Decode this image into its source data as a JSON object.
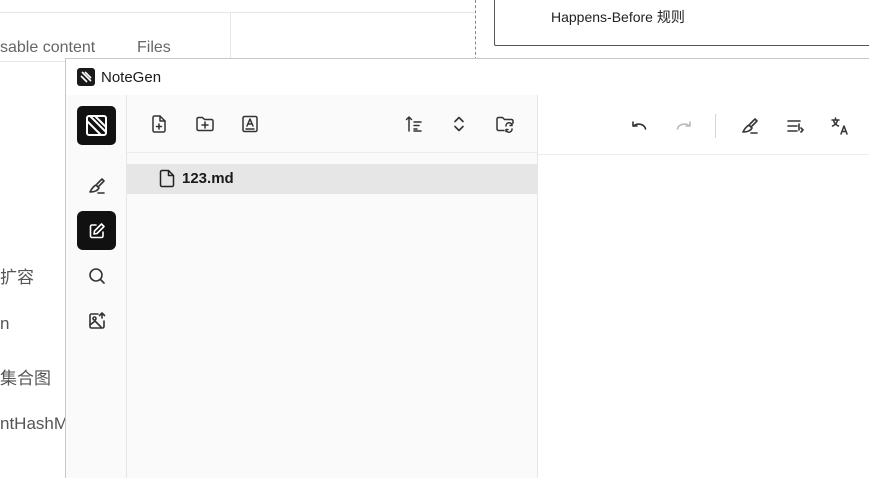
{
  "background": {
    "tabs": [
      "sable content",
      "Files"
    ],
    "sketch_text": "Happens-Before 规则",
    "left_items": [
      "扩容",
      "n",
      "集合图",
      "ntHashM"
    ]
  },
  "window": {
    "title": "NoteGen"
  },
  "rail": {
    "items": [
      "brush-icon",
      "edit-icon",
      "search-icon",
      "image-upload-icon"
    ],
    "active": "edit-icon"
  },
  "file_toolbar": {
    "buttons": [
      "new-file-icon",
      "new-folder-icon",
      "template-icon",
      "sort-icon",
      "expand-collapse-icon",
      "folder-sync-icon"
    ]
  },
  "files": [
    {
      "name": "123.md",
      "icon": "file-icon",
      "selected": true
    }
  ],
  "editor_toolbar": {
    "buttons": [
      "undo-icon",
      "redo-icon",
      "highlight-icon",
      "continue-writing-icon",
      "translate-icon"
    ]
  },
  "colors": {
    "active_bg": "#111111",
    "selected_row": "#e6e6e6",
    "panel_bg": "#fafafa"
  }
}
